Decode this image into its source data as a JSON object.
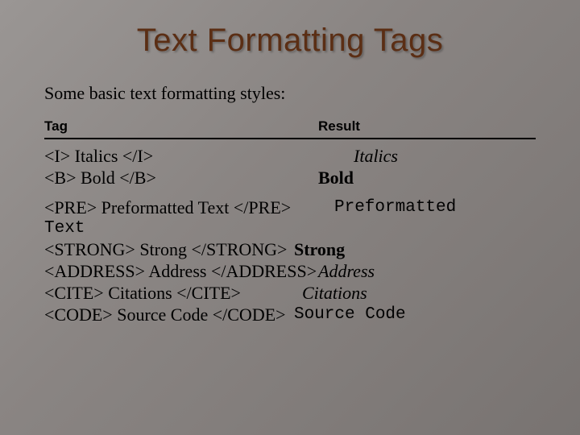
{
  "title": "Text Formatting Tags",
  "intro": "Some basic text formatting styles:",
  "headers": {
    "tag": "Tag",
    "result": "Result"
  },
  "rows": {
    "italics": {
      "tag": "<I> Italics </I>",
      "result": "Italics"
    },
    "bold": {
      "tag": "<B> Bold </B>",
      "result": "Bold"
    },
    "pre": {
      "tag": "<PRE> Preformatted Text </PRE>",
      "result": "Preformatted"
    },
    "pre_wrap": {
      "result": "Text"
    },
    "strong": {
      "tag": "<STRONG> Strong </STRONG>",
      "result": "Strong"
    },
    "address": {
      "tag": "<ADDRESS> Address </ADDRESS>",
      "result": "Address"
    },
    "cite": {
      "tag": "<CITE> Citations </CITE>",
      "result": "Citations"
    },
    "code": {
      "tag": "<CODE> Source Code </CODE>",
      "result": "Source Code"
    }
  }
}
